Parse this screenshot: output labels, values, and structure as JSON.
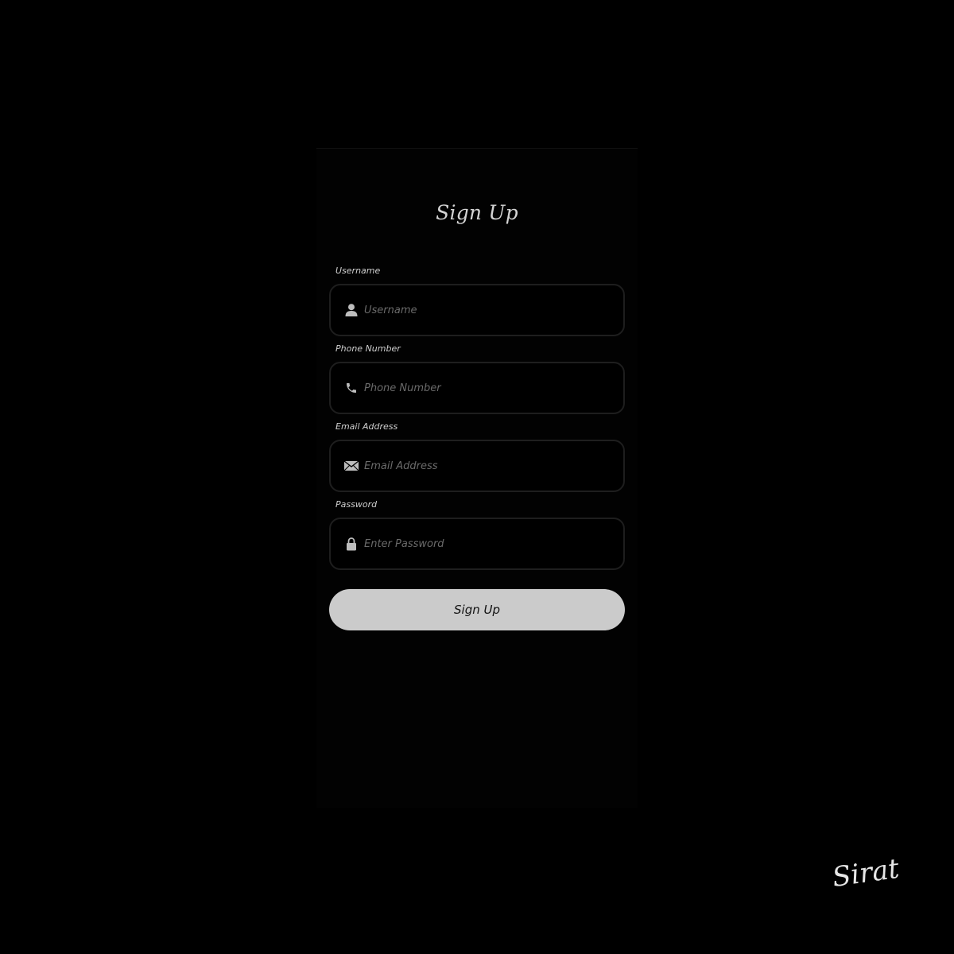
{
  "form": {
    "title": "Sign Up",
    "fields": [
      {
        "label": "Username",
        "placeholder": "Username",
        "value": "",
        "icon": "user-icon"
      },
      {
        "label": "Phone Number",
        "placeholder": "Phone Number",
        "value": "",
        "icon": "phone-icon"
      },
      {
        "label": "Email Address",
        "placeholder": "Email Address",
        "value": "",
        "icon": "envelope-icon"
      },
      {
        "label": "Password",
        "placeholder": "Enter Password",
        "value": "",
        "icon": "lock-icon"
      }
    ],
    "submit_label": "Sign Up"
  },
  "signature": "Sirat",
  "colors": {
    "background": "#000000",
    "button": "#cbcbcb",
    "text": "#d4d4d4",
    "placeholder": "#6a6a6a",
    "border": "#1e1e1e"
  }
}
